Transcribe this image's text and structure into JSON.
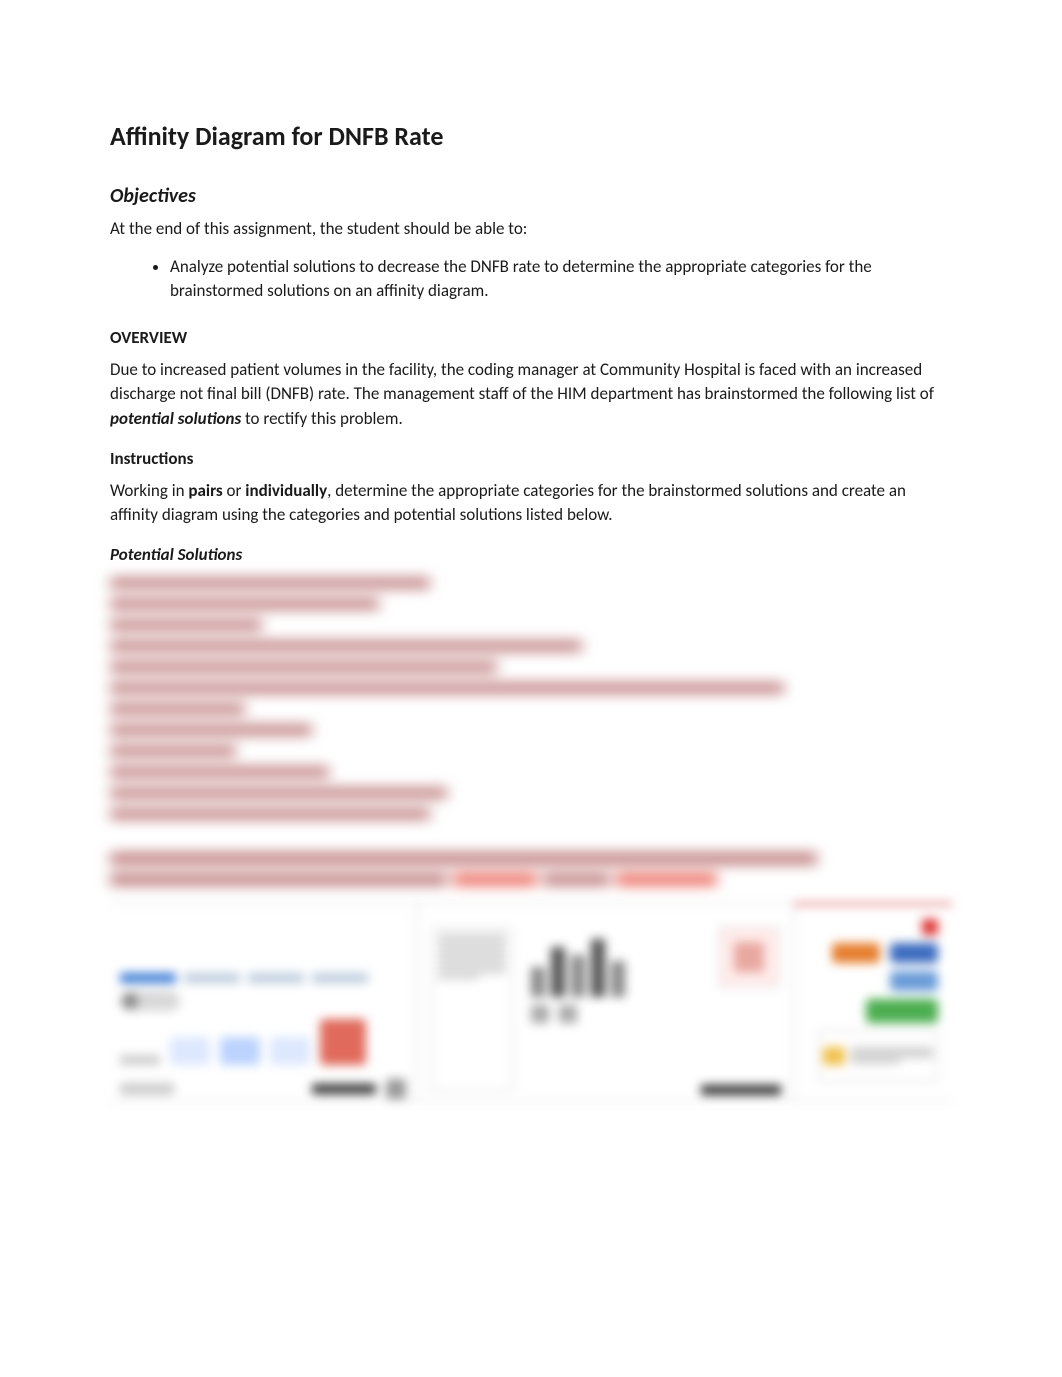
{
  "title": "Affinity Diagram for DNFB Rate",
  "objectives_heading": "Objectives",
  "objectives_intro": "At the end of this assignment, the student should be able to:",
  "objectives_bullets": [
    "Analyze potential solutions to decrease the DNFB rate to determine the appropriate categories for the brainstormed solutions on an affinity diagram."
  ],
  "overview_heading": "OVERVIEW",
  "overview_para_pre": "Due to increased patient volumes in the facility, the coding manager at Community Hospital is faced with an increased discharge not final bill (DNFB) rate. The management staff of the HIM department has brainstormed the following list of ",
  "overview_bold_italic": "potential solutions",
  "overview_para_post": " to rectify this problem.",
  "instructions_heading": "Instructions",
  "instructions_pre": "Working in ",
  "instructions_b1": "pairs",
  "instructions_mid": " or ",
  "instructions_b2": "individually",
  "instructions_post": ", determine the appropriate categories for the brainstormed solutions and create an affinity diagram using the categories and potential solutions listed below.",
  "potential_solutions_heading": "Potential Solutions",
  "blurred_line_widths_pct": [
    38,
    32,
    18,
    56,
    46,
    80,
    16,
    24,
    15,
    26,
    40,
    38
  ],
  "blurred_para": {
    "row1": [
      {
        "w": 84,
        "c": "seg"
      }
    ],
    "row2": [
      {
        "w": 40,
        "c": "seg"
      },
      {
        "w": 10,
        "c": "red"
      },
      {
        "w": 8,
        "c": "seg"
      },
      {
        "w": 12,
        "c": "red"
      }
    ]
  },
  "ui_colors": {
    "orange": "#e67e2e",
    "blue1": "#3c6bbf",
    "blue2": "#6a9bd8",
    "green": "#4cae50"
  }
}
